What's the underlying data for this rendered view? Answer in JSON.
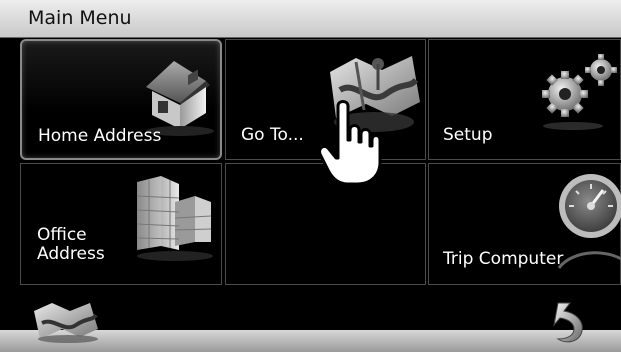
{
  "title": "Main Menu",
  "tiles": [
    {
      "label": "Home Address",
      "icon": "house-icon"
    },
    {
      "label": "Go To...",
      "icon": "map-icon"
    },
    {
      "label": "Setup",
      "icon": "gears-icon"
    },
    {
      "label": "Office\nAddress",
      "icon": "building-icon"
    },
    {
      "label": "",
      "icon": ""
    },
    {
      "label": "Trip Computer",
      "icon": "speedometer-icon"
    }
  ],
  "bottom": {
    "left_icon": "map-icon",
    "right_icon": "back-arrow-icon"
  },
  "cursor": "hand-pointer-icon"
}
